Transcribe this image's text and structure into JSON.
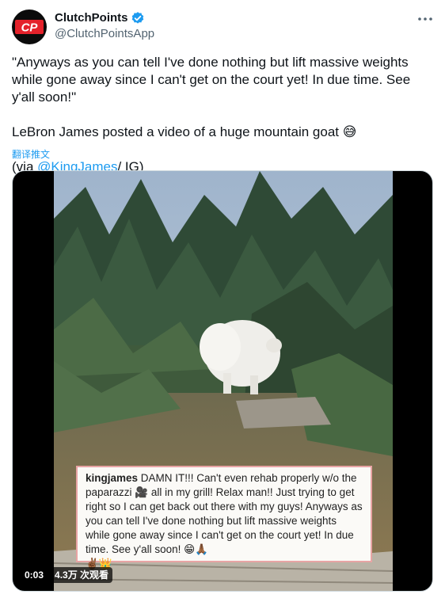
{
  "author": {
    "display_name": "ClutchPoints",
    "handle": "@ClutchPointsApp",
    "avatar_text": "CP",
    "verified": true
  },
  "tweet": {
    "quote": "\"Anyways as you can tell I've done nothing but lift massive weights while gone away since I can't get on the court yet! In due time. See y'all soon!\"",
    "line2_text": "LeBron James posted a video of a huge mountain goat",
    "line2_emoji": "😅",
    "via_prefix": "(via ",
    "via_link": "@KingJames",
    "via_suffix": "/ IG)",
    "translate": "翻译推文"
  },
  "video": {
    "caption_user": "kingjames",
    "caption_text_1": " DAMN IT!!! Can't even rehab properly w/o the paparazzi ",
    "caption_emoji_camera": "🎥",
    "caption_text_2": " all in my grill! Relax man!! Just trying to get right so I can get back out there with my guys! Anyways as you can tell I've done nothing but lift massive weights while gone away since I can't get on the court yet! In due time. See y'all soon! ",
    "caption_emoji_end": "😁🙏🏾",
    "caption_emoji_line2": "✌🏾👑",
    "time": "0:03",
    "views": "4.3万 次观看"
  }
}
